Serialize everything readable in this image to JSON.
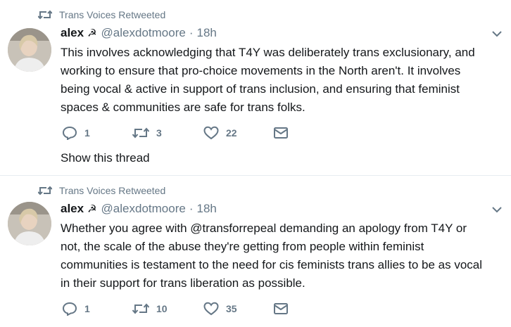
{
  "tweets": [
    {
      "retweeted_by": "Trans Voices Retweeted",
      "name": "alex",
      "name_symbol": "☭",
      "handle": "@alexdotmoore",
      "separator": "·",
      "time": "18h",
      "lines": [
        "This involves acknowledging that T4Y was deliberately trans exclusionary, and",
        "working to ensure that pro-choice movements in the North aren't. It involves",
        "being vocal & active in support of trans inclusion, and ensuring that feminist",
        "spaces & communities are safe for trans folks."
      ],
      "reply_count": "1",
      "retweet_count": "3",
      "like_count": "22",
      "show_thread": "Show this thread"
    },
    {
      "retweeted_by": "Trans Voices Retweeted",
      "name": "alex",
      "name_symbol": "☭",
      "handle": "@alexdotmoore",
      "separator": "·",
      "time": "18h",
      "lines": [
        "Whether you agree with @transforrepeal demanding an apology from T4Y or",
        "not, the scale of the abuse they're getting from people within feminist",
        "communities is testament to the need for cis feminists trans allies to be as vocal",
        "in their support for trans liberation as possible."
      ],
      "reply_count": "1",
      "retweet_count": "10",
      "like_count": "35"
    }
  ],
  "colors": {
    "text": "#14171a",
    "secondary": "#657786",
    "divider": "#e6ecf0"
  },
  "icons": [
    "retweet-icon",
    "reply-icon",
    "like-icon",
    "dm-icon",
    "chevron-down-icon"
  ]
}
